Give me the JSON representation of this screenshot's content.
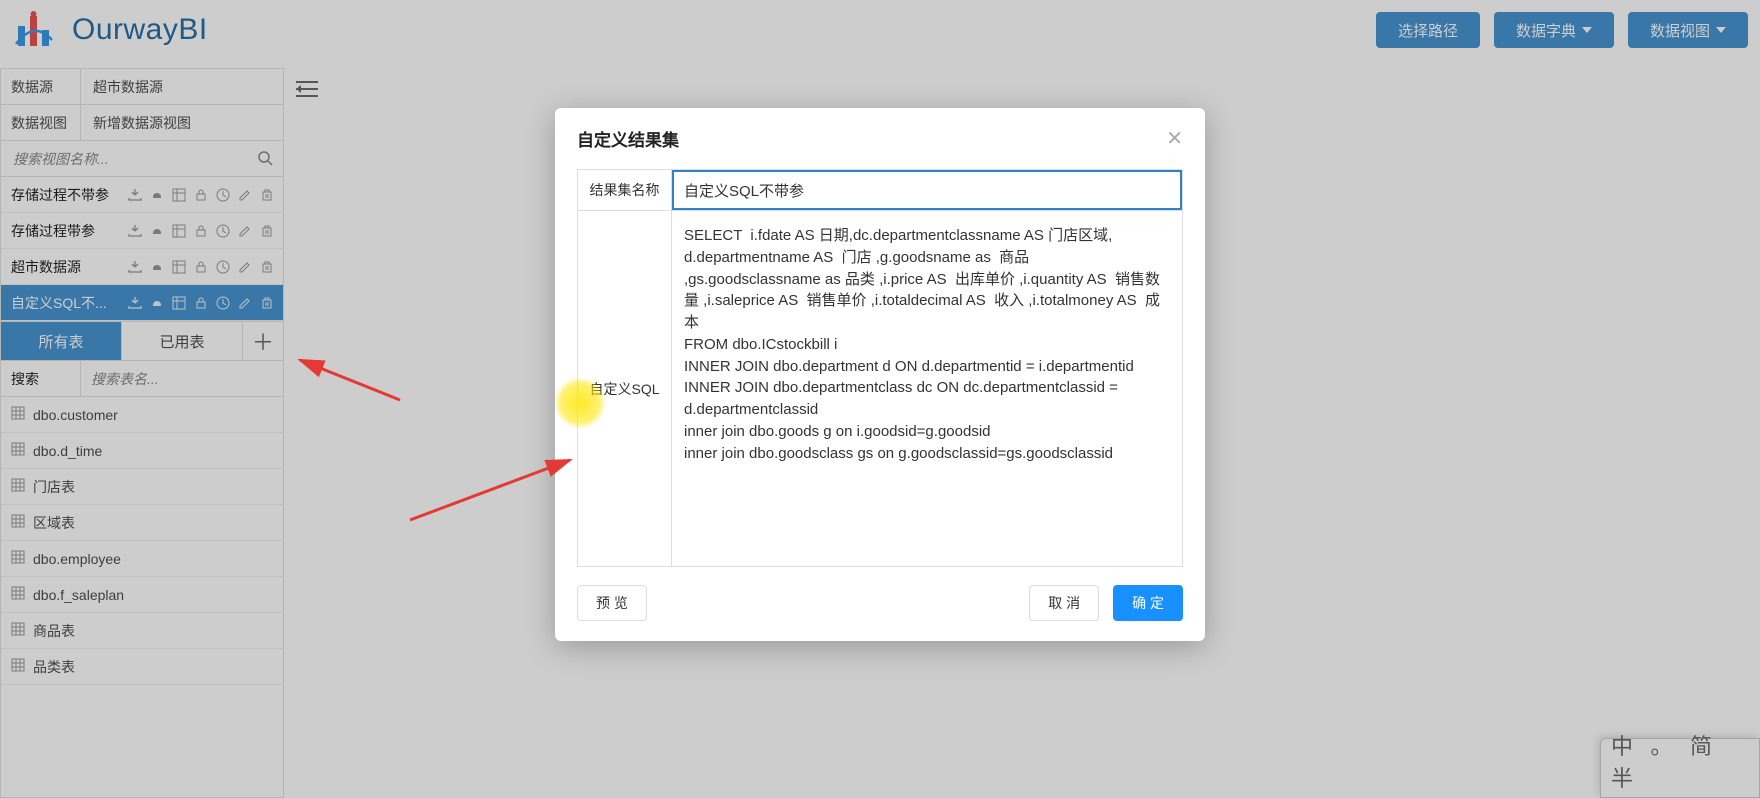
{
  "header": {
    "product_name": "OurwayBI",
    "btn_path": "选择路径",
    "btn_dict": "数据字典",
    "btn_view": "数据视图"
  },
  "left": {
    "rows": [
      {
        "label": "数据源",
        "value": "超市数据源"
      },
      {
        "label": "数据视图",
        "value": "新增数据源视图"
      }
    ],
    "search_placeholder": "搜索视图名称...",
    "views": [
      {
        "name": "存储过程不带参",
        "selected": false
      },
      {
        "name": "存储过程带参",
        "selected": false
      },
      {
        "name": "超市数据源",
        "selected": false
      },
      {
        "name": "自定义SQL不...",
        "selected": true
      }
    ],
    "tab_all": "所有表",
    "tab_used": "已用表",
    "tbl_search_label": "搜索",
    "tbl_search_placeholder": "搜索表名...",
    "tables": [
      "dbo.customer",
      "dbo.d_time",
      "门店表",
      "区域表",
      "dbo.employee",
      "dbo.f_saleplan",
      "商品表",
      "品类表"
    ]
  },
  "modal": {
    "title": "自定义结果集",
    "name_label": "结果集名称",
    "name_value": "自定义SQL不带参",
    "sql_label": "自定义SQL",
    "sql_value": "SELECT  i.fdate AS 日期,dc.departmentclassname AS 门店区域,\nd.departmentname AS  门店 ,g.goodsname as  商品  ,gs.goodsclassname as 品类 ,i.price AS  出库单价 ,i.quantity AS  销售数量 ,i.saleprice AS  销售单价 ,i.totaldecimal AS  收入 ,i.totalmoney AS  成本\nFROM dbo.ICstockbill i\nINNER JOIN dbo.department d ON d.departmentid = i.departmentid\nINNER JOIN dbo.departmentclass dc ON dc.departmentclassid = d.departmentclassid\ninner join dbo.goods g on i.goodsid=g.goodsid\ninner join dbo.goodsclass gs on g.goodsclassid=gs.goodsclassid",
    "btn_preview": "预 览",
    "btn_cancel": "取 消",
    "btn_ok": "确 定"
  },
  "ime": "中 。 简 半"
}
